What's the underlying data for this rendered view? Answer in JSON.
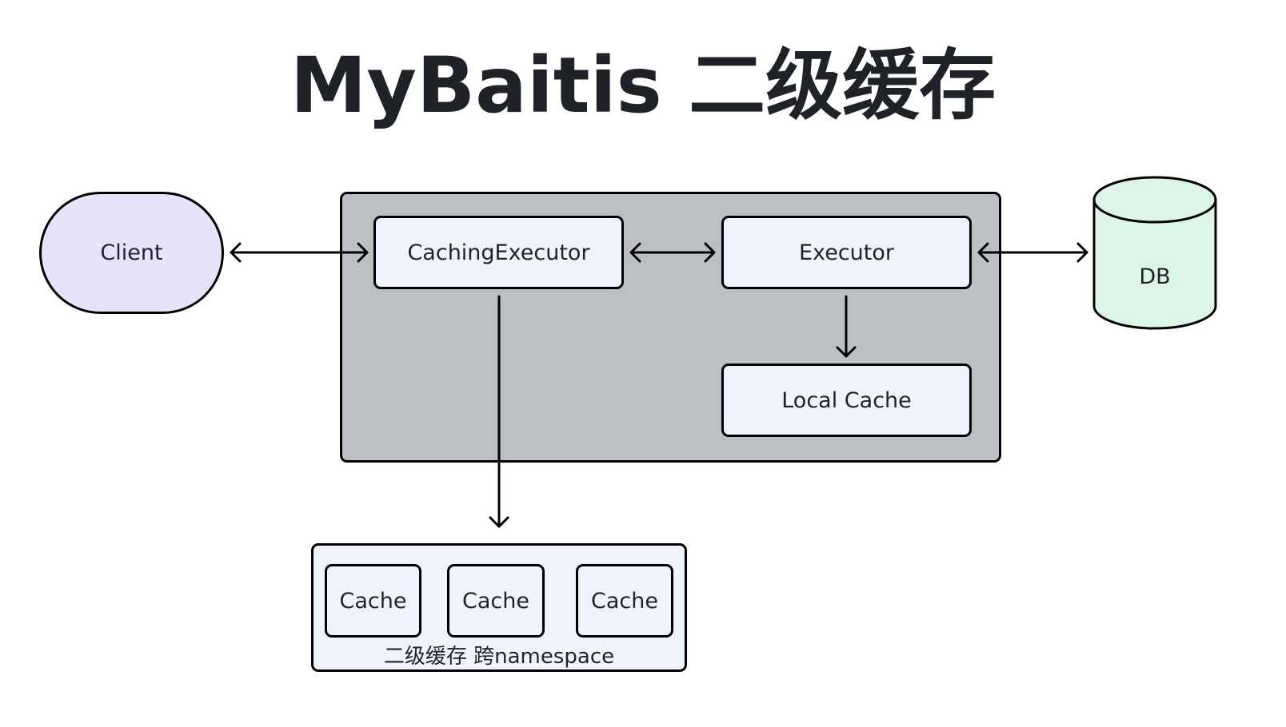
{
  "title": "MyBaitis 二级缓存",
  "nodes": {
    "client": "Client",
    "caching_executor": "CachingExecutor",
    "executor": "Executor",
    "local_cache": "Local Cache",
    "db": "DB",
    "cache_1": "Cache",
    "cache_2": "Cache",
    "cache_3": "Cache"
  },
  "group_label": "二级缓存  跨namespace",
  "colors": {
    "client_fill": "#e8e2fb",
    "container_fill": "#bcbfc4",
    "box_fill": "#eef3fd",
    "db_fill": "#dcf5e6",
    "stroke": "#000000"
  }
}
